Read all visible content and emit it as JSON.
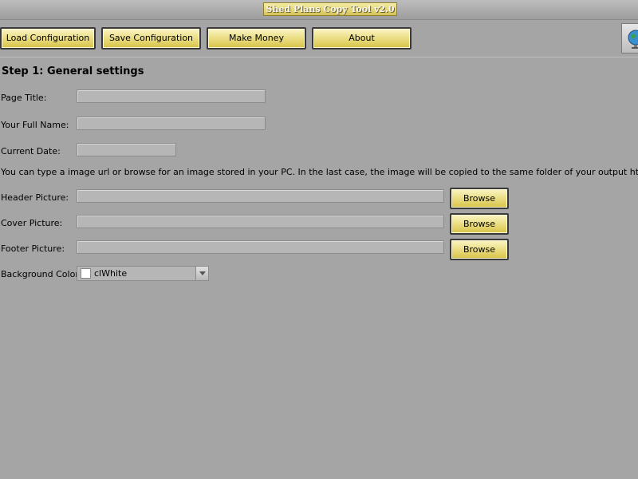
{
  "window": {
    "title": "Shed Plans Copy Tool v2.0"
  },
  "toolbar": {
    "load_label": "Load Configuration",
    "save_label": "Save Configuration",
    "money_label": "Make Money",
    "about_label": "About"
  },
  "step": {
    "heading": "Step 1: General settings"
  },
  "form": {
    "page_title_label": "Page Title:",
    "page_title_value": "",
    "full_name_label": "Your Full Name:",
    "full_name_value": "",
    "date_label": "Current Date:",
    "date_value": "",
    "image_note": "You can type a image url or browse for an image stored in your PC. In the last case, the image will be copied to the same folder of your output html file.",
    "header_label": "Header Picture:",
    "header_value": "",
    "cover_label": "Cover Picture:",
    "cover_value": "",
    "footer_label": "Footer Picture:",
    "footer_value": "",
    "browse_label": "Browse",
    "bg_color_label": "Background Color:",
    "bg_color_value": "clWhite",
    "bg_color_swatch": "#ffffff"
  },
  "icons": {
    "globe": "globe-icon"
  },
  "colors": {
    "background": "#a5a5a5",
    "button_gold": "#e6d56f"
  }
}
